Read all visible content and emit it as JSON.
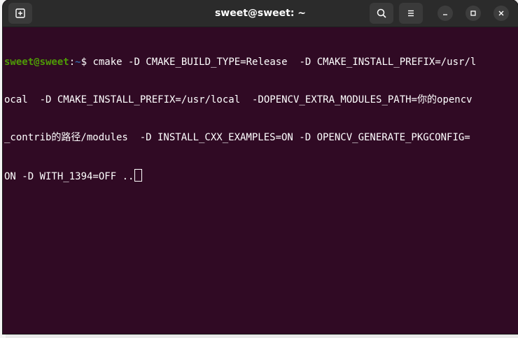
{
  "window": {
    "title": "sweet@sweet: ~"
  },
  "toolbar": {
    "new_tab_icon": "new-tab-icon",
    "search_icon": "search-icon",
    "menu_icon": "hamburger-menu-icon",
    "minimize_icon": "minimize-icon",
    "maximize_icon": "maximize-icon",
    "close_icon": "close-icon"
  },
  "terminal": {
    "prompt_user": "sweet@sweet",
    "prompt_sep": ":",
    "prompt_path": "~",
    "prompt_symbol": "$ ",
    "line1_command": "cmake -D CMAKE_BUILD_TYPE=Release  -D CMAKE_INSTALL_PREFIX=/usr/l",
    "line2": "ocal  -D CMAKE_INSTALL_PREFIX=/usr/local  -DOPENCV_EXTRA_MODULES_PATH=你的opencv",
    "line3": "_contrib的路径/modules  -D INSTALL_CXX_EXAMPLES=ON -D OPENCV_GENERATE_PKGCONFIG=",
    "line4": "ON -D WITH_1394=OFF .."
  },
  "colors": {
    "terminal_bg": "#300a24",
    "titlebar_bg": "#2b2b2b",
    "prompt_user": "#4e9a06",
    "prompt_path": "#3465a4"
  }
}
